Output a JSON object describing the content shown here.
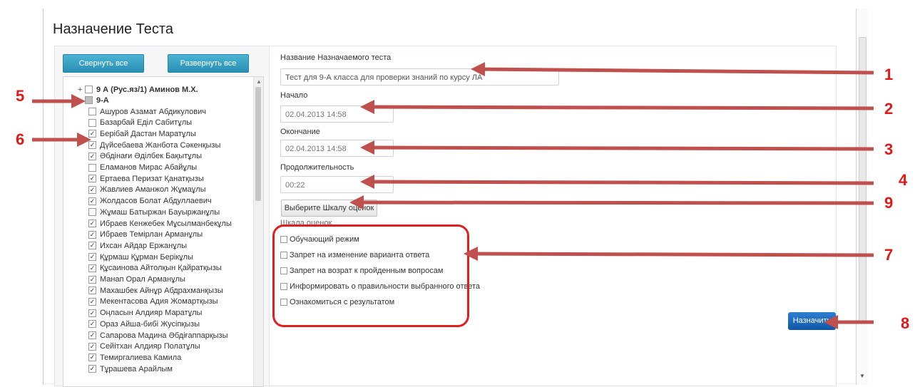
{
  "page": {
    "title": "Назначение Теста"
  },
  "buttons": {
    "collapse_all": "Свернуть все",
    "expand_all": "Развернуть все",
    "select_scale": "Выберите Шкалу оценок",
    "assign": "Назначить"
  },
  "tree": {
    "groups": [
      {
        "label": "9 А (Рус.яз/1) Аминов М.Х.",
        "expander": "+"
      },
      {
        "label": "9-А",
        "expander": "−"
      }
    ],
    "students": [
      {
        "name": "Ашуров Азамат Абдикулович",
        "checked": false
      },
      {
        "name": "Базарбай Едiл Сабитұлы",
        "checked": false
      },
      {
        "name": "Берiбай Дастан Маратұлы",
        "checked": true
      },
      {
        "name": "Дүйсебаева Жанбота Сәкенқызы",
        "checked": true
      },
      {
        "name": "Әбдiнағи Әдiлбек Бақытұлы",
        "checked": true
      },
      {
        "name": "Еламанов Мирас Абайұлы",
        "checked": false
      },
      {
        "name": "Ертаева Перизат Қанатқызы",
        "checked": true
      },
      {
        "name": "Жавлиев Аманжол Жұмаұлы",
        "checked": true
      },
      {
        "name": "Жолдасов Болат Абдуллаевич",
        "checked": true
      },
      {
        "name": "Жұмаш Батыржан Бауыржанұлы",
        "checked": false
      },
      {
        "name": "Ибраев Кенжебек Мұсылманбекұлы",
        "checked": true
      },
      {
        "name": "Ибраев Темiрлан Арманұлы",
        "checked": true
      },
      {
        "name": "Ихсан Айдар Ержанұлы",
        "checked": true
      },
      {
        "name": "Құрмаш Құрман Берiкұлы",
        "checked": true
      },
      {
        "name": "Құсаинова Айтолқын Қайратқызы",
        "checked": true
      },
      {
        "name": "Манап Орал Арманұлы",
        "checked": true
      },
      {
        "name": "Махашбек Айнұр Абдрахманқызы",
        "checked": true
      },
      {
        "name": "Мекентасова Адия Жомартқызы",
        "checked": true
      },
      {
        "name": "Оңласын Алдияр Маратұлы",
        "checked": true
      },
      {
        "name": "Ораз Айша-бибi Жусiпқызы",
        "checked": true
      },
      {
        "name": "Сапарова Мадина Әбдiғаппарқызы",
        "checked": true
      },
      {
        "name": "Сейiтхан Алдияр Полатұлы",
        "checked": true
      },
      {
        "name": "Темиргалиева Камила",
        "checked": true
      },
      {
        "name": "Тұрашева Арайлым",
        "checked": true
      }
    ]
  },
  "form": {
    "test_name_label": "Название Назначаемого теста",
    "test_name_value": "Тест для 9-А класса для проверки знаний по курсу ЛА",
    "start_label": "Начало",
    "start_value": "02.04.2013 14:58",
    "end_label": "Окончание",
    "end_value": "02.04.2013 14:58",
    "duration_label": "Продолжительность",
    "duration_value": "00:22",
    "scale_label": "Шкала оценок"
  },
  "options": [
    "Обучающий режим",
    "Запрет на изменение варианта ответа",
    "Запрет на возрат к пройденным вопросам",
    "Информировать о правильности выбранного ответа",
    "Ознакомиться с результатом"
  ],
  "annotations": [
    "1",
    "2",
    "3",
    "4",
    "5",
    "6",
    "7",
    "8",
    "9"
  ],
  "colors": {
    "annotation_red": "#e01818",
    "arrow": "#c0504d",
    "primary_blue": "#0d57a8",
    "teal_button": "#2a8fb4"
  }
}
